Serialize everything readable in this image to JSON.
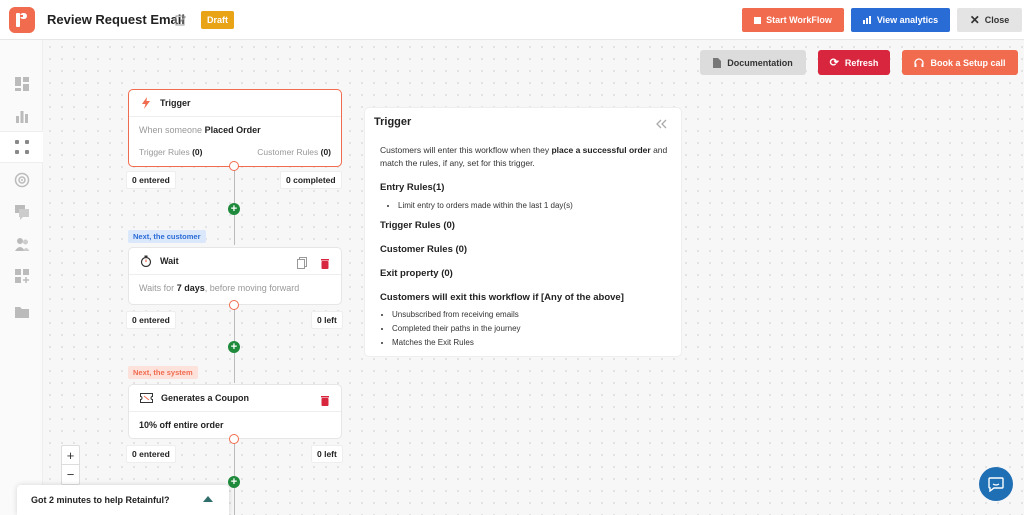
{
  "header": {
    "title": "Review Request Email",
    "badge": "Draft",
    "start_label": "Start WorkFlow",
    "analytics_label": "View analytics",
    "close_label": "Close"
  },
  "toolbar": {
    "documentation_label": "Documentation",
    "refresh_label": "Refresh",
    "setup_label": "Book a Setup call"
  },
  "sidebar": {
    "icons": [
      "dashboard-icon",
      "chart-icon",
      "workflow-icon",
      "target-icon",
      "chat-icon",
      "users-icon",
      "add-widget-icon",
      "folder-icon"
    ]
  },
  "nodes": {
    "trigger": {
      "title": "Trigger",
      "prefix": "When someone",
      "event": "Placed Order",
      "trigger_rules_label": "Trigger Rules",
      "trigger_rules_count": "(0)",
      "customer_rules_label": "Customer Rules",
      "customer_rules_count": "(0)",
      "entered": "0 entered",
      "completed": "0 completed"
    },
    "tag_customer": "Next, the customer",
    "wait": {
      "title": "Wait",
      "prefix": "Waits for",
      "duration": "7 days",
      "suffix": ", before moving forward",
      "entered": "0 entered",
      "left": "0 left"
    },
    "tag_system": "Next, the system",
    "coupon": {
      "title": "Generates a Coupon",
      "body": "10% off entire order",
      "entered": "0 entered",
      "left": "0 left"
    }
  },
  "panel": {
    "title": "Trigger",
    "desc_1": "Customers will enter this workflow when they ",
    "desc_bold": "place a successful order",
    "desc_2": " and match the rules, if any, set for this trigger.",
    "entry_rules": "Entry Rules(1)",
    "entry_items": [
      "Limit entry to orders made within the last 1 day(s)"
    ],
    "trigger_rules": "Trigger Rules  (0)",
    "customer_rules": "Customer Rules  (0)",
    "exit_property": "Exit property  (0)",
    "exit_heading": "Customers will exit this workflow if [Any of the above]",
    "exit_items": [
      "Unsubscribed from receiving emails",
      "Completed their paths in the journey",
      "Matches the Exit Rules"
    ]
  },
  "zoom": {
    "in": "+",
    "out": "−"
  },
  "feedback": {
    "text": "Got 2 minutes to help Retainful?"
  },
  "colors": {
    "brand": "#f16b4e",
    "primary": "#2a6cd6",
    "danger": "#d7263d",
    "add": "#1f8a3b"
  }
}
